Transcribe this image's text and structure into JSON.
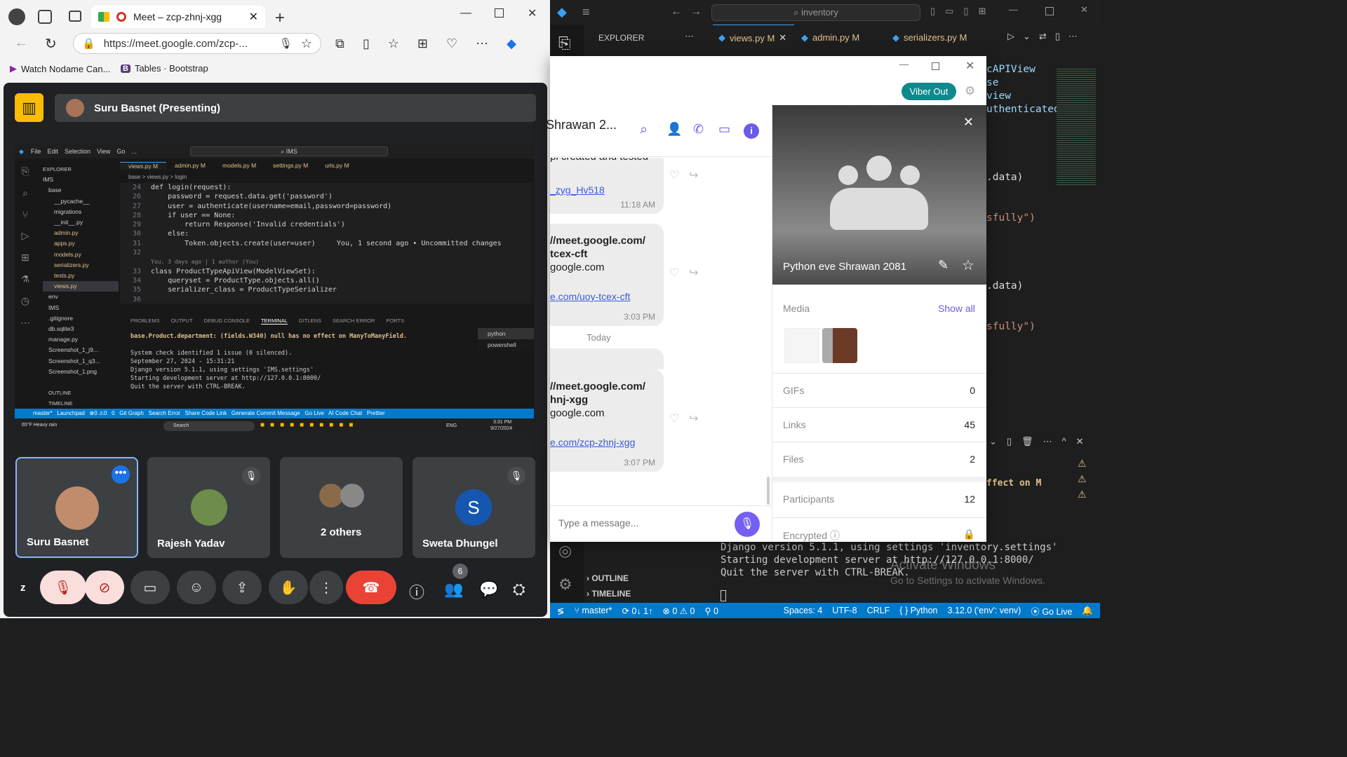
{
  "browser": {
    "tab_title": "Meet – zcp-zhnj-xgg",
    "url": "https://meet.google.com/zcp-...",
    "bookmarks": [
      "Watch Nodame Can...",
      "Tables · Bootstrap"
    ]
  },
  "meet": {
    "presenter": "Suru Basnet (Presenting)",
    "participants": [
      {
        "name": "Suru Basnet"
      },
      {
        "name": "Rajesh Yadav"
      },
      {
        "name": "2 others"
      },
      {
        "name": "Sweta Dhungel",
        "initial": "S"
      }
    ],
    "participant_count": "6",
    "self_label": "z"
  },
  "shared": {
    "menu": [
      "File",
      "Edit",
      "Selection",
      "View",
      "Go",
      "..."
    ],
    "search": "IMS",
    "tabs": [
      "views.py M",
      "admin.py M",
      "models.py M",
      "settings.py M",
      "urls.py M"
    ],
    "explorer_title": "EXPLORER",
    "tree": [
      "IMS",
      "base",
      "__pycache__",
      "migrations",
      "__init__.py",
      "admin.py",
      "apps.py",
      "models.py",
      "serializers.py",
      "tests.py",
      "views.py",
      "env",
      "IMS",
      ".gitignore",
      "db.sqlite3",
      "manage.py",
      "Screenshot_1_j9...",
      "Screenshot_1_q3...",
      "Screenshot_1.png"
    ],
    "outline": "OUTLINE",
    "timeline": "TIMELINE",
    "breadcrumb": "base > views.py > login",
    "code": [
      {
        "n": "24",
        "t": "def login(request):"
      },
      {
        "n": "26",
        "t": "    password = request.data.get('password')"
      },
      {
        "n": "27",
        "t": "    user = authenticate(username=email,password=password)"
      },
      {
        "n": "28",
        "t": "    if user == None:"
      },
      {
        "n": "29",
        "t": "        return Response('Invalid credentials')"
      },
      {
        "n": "30",
        "t": "    else:"
      },
      {
        "n": "31",
        "t": "        Token.objects.create(user=user)     You, 1 second ago • Uncommitted changes"
      },
      {
        "n": "32",
        "t": ""
      },
      {
        "n": "",
        "t": "You, 3 days ago | 1 author (You)"
      },
      {
        "n": "33",
        "t": "class ProductTypeApiView(ModelViewSet):"
      },
      {
        "n": "34",
        "t": "    queryset = ProductType.objects.all()"
      },
      {
        "n": "35",
        "t": "    serializer_class = ProductTypeSerializer"
      },
      {
        "n": "36",
        "t": ""
      }
    ],
    "panel_tabs": [
      "PROBLEMS",
      "OUTPUT",
      "DEBUG CONSOLE",
      "TERMINAL",
      "GITLENS",
      "SEARCH ERROR",
      "PORTS"
    ],
    "terminal": [
      "base.Product.department: (fields.W340) null has no effect on ManyToManyField.",
      "",
      "System check identified 1 issue (0 silenced).",
      "September 27, 2024 - 15:31:21",
      "Django version 5.1.1, using settings 'IMS.settings'",
      "Starting development server at http://127.0.0.1:8000/",
      "Quit the server with CTRL-BREAK."
    ],
    "shells": [
      "python",
      "powershell"
    ],
    "status": "master*   Launchpad   ⊗0 ⚠0   0   Git Graph   Search Error   Share Code Link   Generate Commit Message   Go Live   AI Code Chat   Prettier",
    "weather": "65°F Heavy rain",
    "taskbar_search": "Search",
    "clock_time": "3:31 PM",
    "clock_date": "9/27/2024",
    "lang": "ENG"
  },
  "vscode": {
    "search": "inventory",
    "explorer": "EXPLORER",
    "tabs": [
      "views.py M",
      "admin.py M",
      "serializers.py M"
    ],
    "code_right": [
      "cAPIView",
      "se",
      "view",
      "uthenticated",
      ".data)",
      "sfully\")",
      ".data)",
      "sfully\")"
    ],
    "terminal_right": "ffect on M",
    "terminal": [
      "Django version 5.1.1, using settings 'inventory.settings'",
      "Starting development server at http://127.0.0.1:8000/",
      "Quit the server with CTRL-BREAK."
    ],
    "outline": "OUTLINE",
    "timeline": "TIMELINE",
    "activate_title": "Activate Windows",
    "activate_sub": "Go to Settings to activate Windows.",
    "status": {
      "branch": "master*",
      "sync": "0↓ 1↑",
      "errors": "0",
      "warnings": "0",
      "ports": "0",
      "spaces": "Spaces: 4",
      "enc": "UTF-8",
      "eol": "CRLF",
      "lang": "Python",
      "interp": "3.12.0 ('env': venv)",
      "live": "Go Live"
    }
  },
  "viber": {
    "viber_out": "Viber Out",
    "chat_name": "Shrawan 2...",
    "messages": [
      {
        "lines": [
          "pi created and tested"
        ],
        "link": "_zyg_Hv518",
        "time": "11:18 AM"
      },
      {
        "lines": [
          "//meet.google.com/",
          "tcex-cft",
          "google.com"
        ],
        "link": "e.com/uoy-tcex-cft",
        "time": "3:03 PM"
      },
      {
        "lines": [
          "//meet.google.com/",
          "hnj-xgg",
          "google.com"
        ],
        "link": "e.com/zcp-zhnj-xgg",
        "time": "3:07 PM"
      }
    ],
    "day_sep": "Today",
    "composer_placeholder": "Type a message...",
    "group_name": "Python eve Shrawan 2081",
    "media": "Media",
    "show_all": "Show all",
    "stats": [
      {
        "label": "GIFs",
        "value": "0"
      },
      {
        "label": "Links",
        "value": "45"
      },
      {
        "label": "Files",
        "value": "2"
      },
      {
        "label": "Participants",
        "value": "12"
      }
    ],
    "encrypted": "Encrypted"
  }
}
